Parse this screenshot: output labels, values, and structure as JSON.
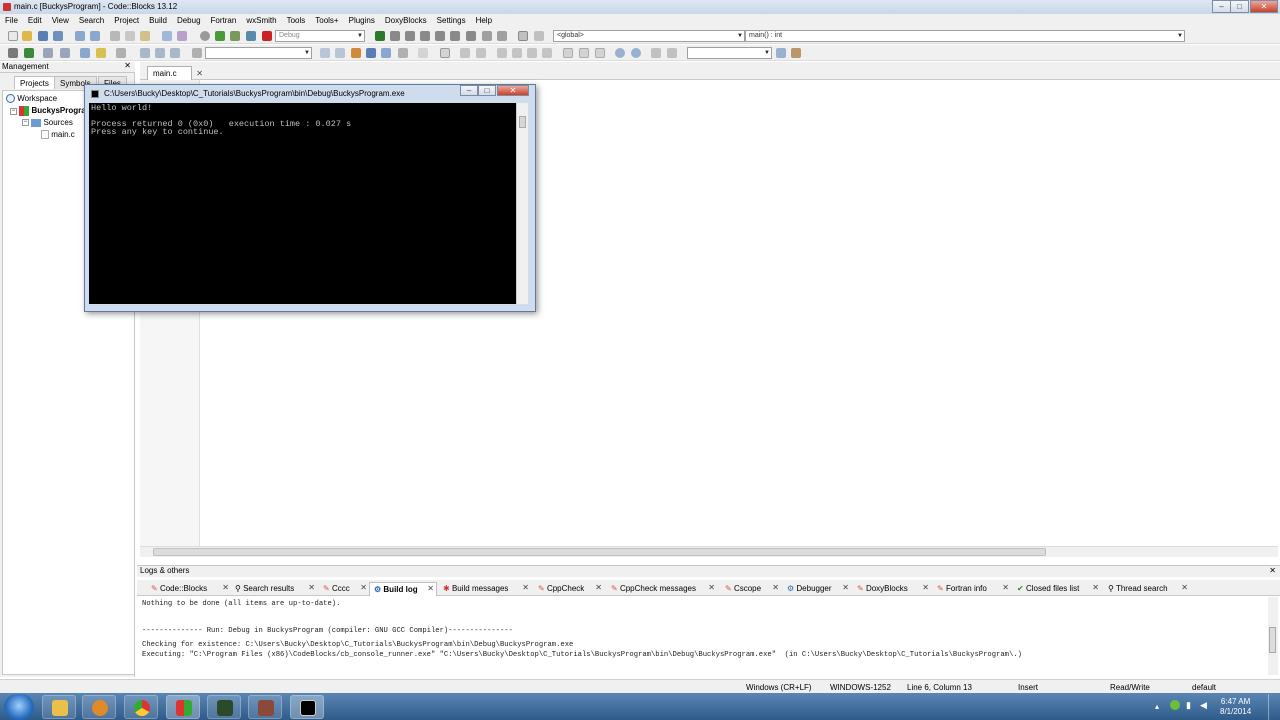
{
  "window": {
    "title": "main.c [BuckysProgram] - Code::Blocks 13.12",
    "minimize_glyph": "–",
    "maximize_glyph": "□",
    "close_glyph": "✕"
  },
  "menu": [
    "File",
    "Edit",
    "View",
    "Search",
    "Project",
    "Build",
    "Debug",
    "Fortran",
    "wxSmith",
    "Tools",
    "Tools+",
    "Plugins",
    "DoxyBlocks",
    "Settings",
    "Help"
  ],
  "toolbar": {
    "build_target": "Debug",
    "scope": "<global>",
    "function": "main() : int"
  },
  "management": {
    "title": "Management",
    "tabs": [
      "Projects",
      "Symbols",
      "Files"
    ],
    "tree": {
      "workspace": "Workspace",
      "project": "BuckysProgram",
      "folder": "Sources",
      "file": "main.c"
    }
  },
  "editor": {
    "tab_label": "main.c"
  },
  "console": {
    "title": "C:\\Users\\Bucky\\Desktop\\C_Tutorials\\BuckysProgram\\bin\\Debug\\BuckysProgram.exe",
    "output": "Hello world!\n\nProcess returned 0 (0x0)   execution time : 0.027 s\nPress any key to continue."
  },
  "logs": {
    "title": "Logs & others",
    "tabs": [
      "Code::Blocks",
      "Search results",
      "Cccc",
      "Build log",
      "Build messages",
      "CppCheck",
      "CppCheck messages",
      "Cscope",
      "Debugger",
      "DoxyBlocks",
      "Fortran info",
      "Closed files list",
      "Thread search"
    ],
    "active_tab": "Build log",
    "lines": [
      "Nothing to be done (all items are up-to-date).",
      "",
      "",
      "-------------- Run: Debug in BuckysProgram (compiler: GNU GCC Compiler)---------------",
      "",
      "Checking for existence: C:\\Users\\Bucky\\Desktop\\C_Tutorials\\BuckysProgram\\bin\\Debug\\BuckysProgram.exe",
      "Executing: \"C:\\Program Files (x86)\\CodeBlocks/cb_console_runner.exe\" \"C:\\Users\\Bucky\\Desktop\\C_Tutorials\\BuckysProgram\\bin\\Debug\\BuckysProgram.exe\"  (in C:\\Users\\Bucky\\Desktop\\C_Tutorials\\BuckysProgram\\.)"
    ]
  },
  "status": {
    "line_endings": "Windows (CR+LF)",
    "encoding": "WINDOWS-1252",
    "position": "Line 6, Column 13",
    "mode": "Insert",
    "access": "Read/Write",
    "profile": "default"
  },
  "taskbar": {
    "time": "6:47 AM",
    "date": "8/1/2014"
  },
  "colors": {
    "taskbar": "#2f5b8b",
    "console_bg": "#000000",
    "active_title": "#cfdcee"
  }
}
